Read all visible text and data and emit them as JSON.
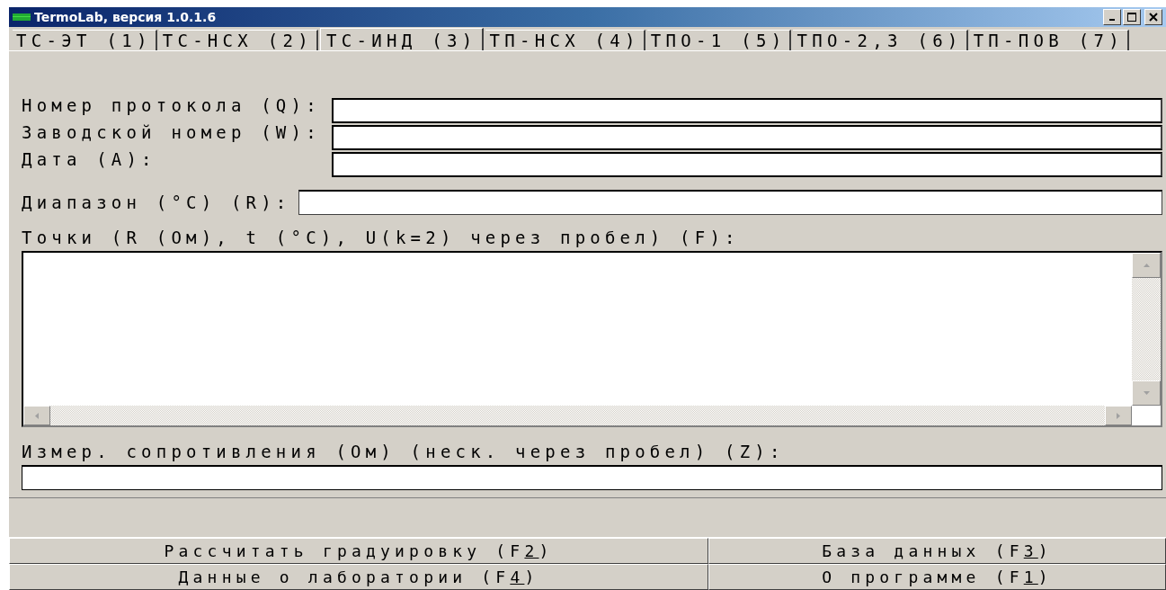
{
  "window": {
    "title": "TermoLab, версия 1.0.1.6"
  },
  "tabs": [
    {
      "label": "ТС-ЭТ (1)",
      "selected": false
    },
    {
      "label": "ТС-НСХ (2)",
      "selected": false
    },
    {
      "label": "ТС-ИНД (3)",
      "selected": true
    },
    {
      "label": "ТП-НСХ (4)",
      "selected": false
    },
    {
      "label": "ТПО-1 (5)",
      "selected": false
    },
    {
      "label": "ТПО-2,3 (6)",
      "selected": false
    },
    {
      "label": "ТП-ПОВ (7)",
      "selected": false
    }
  ],
  "header_fields": [
    {
      "label": "Номер протокола (Q):"
    },
    {
      "label": "Заводской номер (W):"
    },
    {
      "label": "Дата (A):"
    }
  ],
  "range_field": {
    "label": "Диапазон (°C) (R):"
  },
  "points": {
    "label": "Точки (R (Ом), t (°C), U(k=2) через пробел) (F):"
  },
  "measure_field": {
    "label": "Измер. сопротивления (Ом) (неск. через пробел) (Z):"
  },
  "buttons": [
    {
      "before": "Рассчитать градуировку (F",
      "key": "2",
      "after": ")"
    },
    {
      "before": "База данных (F",
      "key": "3",
      "after": ")"
    },
    {
      "before": "Данные о лаборатории (F",
      "key": "4",
      "after": ")"
    },
    {
      "before": "О программе (F",
      "key": "1",
      "after": ")"
    }
  ]
}
